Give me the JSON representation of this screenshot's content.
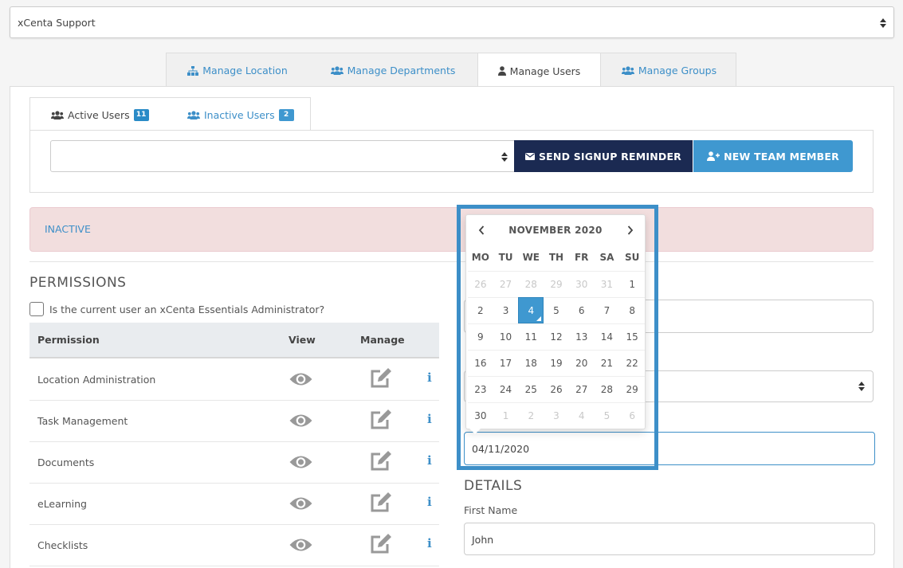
{
  "top_select": {
    "value": "xCenta Support"
  },
  "main_tabs": [
    {
      "label": "Manage Location",
      "icon": "sitemap-icon"
    },
    {
      "label": "Manage Departments",
      "icon": "users-icon"
    },
    {
      "label": "Manage Users",
      "icon": "user-icon"
    },
    {
      "label": "Manage Groups",
      "icon": "users-icon"
    }
  ],
  "sub_tabs": [
    {
      "label": "Active Users",
      "badge": "11",
      "badge_color": "#2a8bc7"
    },
    {
      "label": "Inactive Users",
      "badge": "2",
      "badge_color": "#3f98d0"
    }
  ],
  "toolbar": {
    "send_reminder_label": "SEND SIGNUP REMINDER",
    "new_member_label": "NEW TEAM MEMBER"
  },
  "alert": {
    "text": "INACTIVE"
  },
  "permissions": {
    "title": "PERMISSIONS",
    "admin_question": "Is the current user an xCenta Essentials Administrator?",
    "headers": {
      "permission": "Permission",
      "view": "View",
      "manage": "Manage"
    },
    "rows": [
      {
        "name": "Location Administration"
      },
      {
        "name": "Task Management"
      },
      {
        "name": "Documents"
      },
      {
        "name": "eLearning"
      },
      {
        "name": "Checklists"
      }
    ]
  },
  "calendar": {
    "title": "NOVEMBER 2020",
    "weekdays": [
      "MO",
      "TU",
      "WE",
      "TH",
      "FR",
      "SA",
      "SU"
    ],
    "days": [
      {
        "d": "26",
        "muted": true
      },
      {
        "d": "27",
        "muted": true
      },
      {
        "d": "28",
        "muted": true
      },
      {
        "d": "29",
        "muted": true
      },
      {
        "d": "30",
        "muted": true
      },
      {
        "d": "31",
        "muted": true
      },
      {
        "d": "1"
      },
      {
        "d": "2"
      },
      {
        "d": "3"
      },
      {
        "d": "4",
        "selected": true
      },
      {
        "d": "5"
      },
      {
        "d": "6"
      },
      {
        "d": "7"
      },
      {
        "d": "8"
      },
      {
        "d": "9"
      },
      {
        "d": "10"
      },
      {
        "d": "11"
      },
      {
        "d": "12"
      },
      {
        "d": "13"
      },
      {
        "d": "14"
      },
      {
        "d": "15"
      },
      {
        "d": "16"
      },
      {
        "d": "17"
      },
      {
        "d": "18"
      },
      {
        "d": "19"
      },
      {
        "d": "20"
      },
      {
        "d": "21"
      },
      {
        "d": "22"
      },
      {
        "d": "23"
      },
      {
        "d": "24"
      },
      {
        "d": "25"
      },
      {
        "d": "26"
      },
      {
        "d": "27"
      },
      {
        "d": "28"
      },
      {
        "d": "29"
      },
      {
        "d": "30"
      },
      {
        "d": "1",
        "muted": true
      },
      {
        "d": "2",
        "muted": true
      },
      {
        "d": "3",
        "muted": true
      },
      {
        "d": "4",
        "muted": true
      },
      {
        "d": "5",
        "muted": true
      },
      {
        "d": "6",
        "muted": true
      }
    ]
  },
  "date_field": {
    "value": "04/11/2020"
  },
  "details": {
    "title": "DETAILS",
    "first_name_label": "First Name",
    "first_name_value": "John"
  },
  "colors": {
    "accent": "#3f98d0",
    "dark_button": "#1b2a52",
    "alert_bg": "#f2dede"
  }
}
